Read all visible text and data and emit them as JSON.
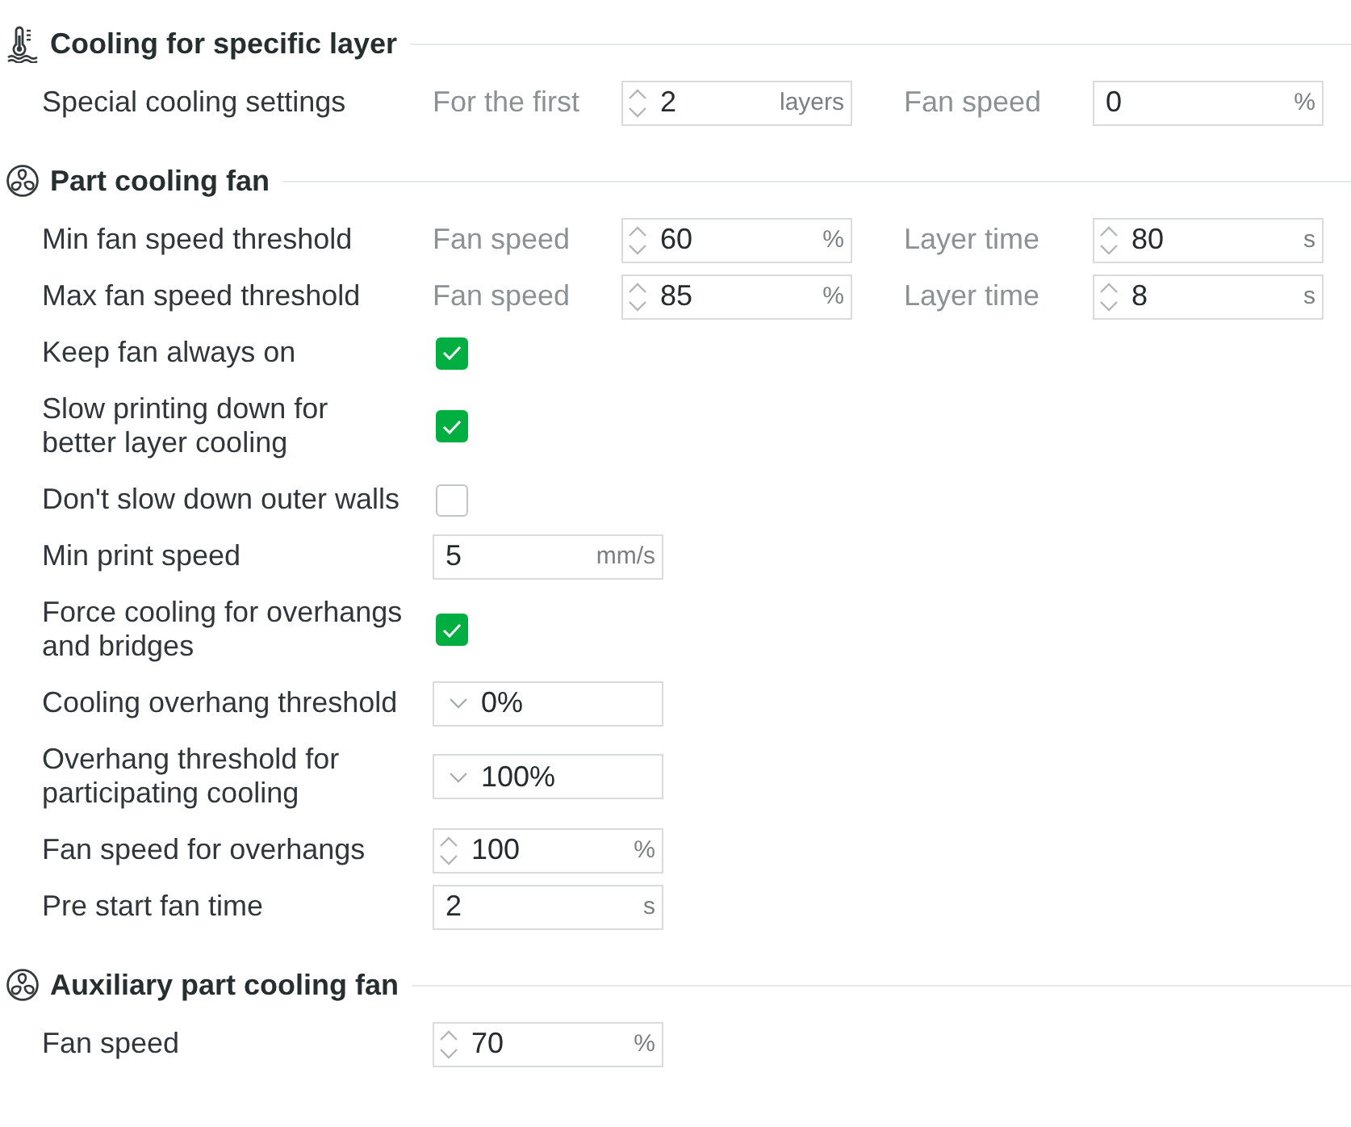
{
  "sections": [
    {
      "kind": "thermometer",
      "title": "Cooling for specific layer",
      "rows": [
        {
          "label": "Special cooling settings",
          "controls": [
            {
              "kind": "caption",
              "text": "For the first"
            },
            {
              "kind": "spin",
              "value": "2",
              "unit": "layers"
            },
            {
              "kind": "caption",
              "text": "Fan speed"
            },
            {
              "kind": "input",
              "value": "0",
              "unit": "%"
            }
          ]
        }
      ]
    },
    {
      "kind": "fan",
      "title": "Part cooling fan",
      "rows": [
        {
          "label": "Min fan speed threshold",
          "controls": [
            {
              "kind": "caption",
              "text": "Fan speed"
            },
            {
              "kind": "spin",
              "value": "60",
              "unit": "%"
            },
            {
              "kind": "caption",
              "text": "Layer time"
            },
            {
              "kind": "spin",
              "value": "80",
              "unit": "s"
            }
          ]
        },
        {
          "label": "Max fan speed threshold",
          "controls": [
            {
              "kind": "caption",
              "text": "Fan speed"
            },
            {
              "kind": "spin",
              "value": "85",
              "unit": "%"
            },
            {
              "kind": "caption",
              "text": "Layer time"
            },
            {
              "kind": "spin",
              "value": "8",
              "unit": "s"
            }
          ]
        },
        {
          "label": "Keep fan always on",
          "controls": [
            {
              "kind": "checkbox",
              "checked": true
            }
          ]
        },
        {
          "label": "Slow printing down for\nbetter layer cooling",
          "controls": [
            {
              "kind": "checkbox",
              "checked": true
            }
          ]
        },
        {
          "label": "Don't slow down outer walls",
          "controls": [
            {
              "kind": "checkbox",
              "checked": false
            }
          ]
        },
        {
          "label": "Min print speed",
          "controls": [
            {
              "kind": "input",
              "value": "5",
              "unit": "mm/s"
            }
          ]
        },
        {
          "label": "Force cooling for overhangs\nand bridges",
          "controls": [
            {
              "kind": "checkbox",
              "checked": true
            }
          ]
        },
        {
          "label": "Cooling overhang threshold",
          "controls": [
            {
              "kind": "dropdown",
              "value": "0%"
            }
          ]
        },
        {
          "label": "Overhang threshold for\nparticipating cooling",
          "controls": [
            {
              "kind": "dropdown",
              "value": "100%"
            }
          ]
        },
        {
          "label": "Fan speed for overhangs",
          "controls": [
            {
              "kind": "spin",
              "value": "100",
              "unit": "%"
            }
          ]
        },
        {
          "label": "Pre start fan time",
          "controls": [
            {
              "kind": "input",
              "value": "2",
              "unit": "s"
            }
          ]
        }
      ]
    },
    {
      "kind": "fan",
      "title": "Auxiliary part cooling fan",
      "rows": [
        {
          "label": "Fan speed",
          "controls": [
            {
              "kind": "spin",
              "value": "70",
              "unit": "%"
            }
          ]
        }
      ]
    }
  ]
}
